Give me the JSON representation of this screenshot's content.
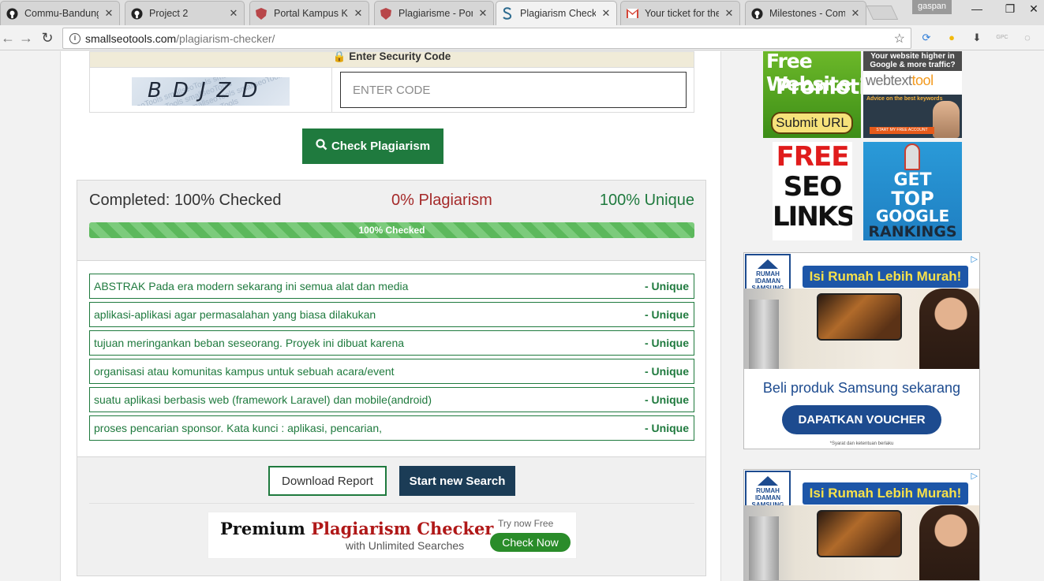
{
  "browser": {
    "tabs": [
      {
        "title": "Commu-Bandung",
        "icon": "github-icon",
        "active": false
      },
      {
        "title": "Project 2",
        "icon": "github-icon",
        "active": false
      },
      {
        "title": "Portal Kampus Ke",
        "icon": "campus-shield-icon",
        "active": false
      },
      {
        "title": "Plagiarisme - Port",
        "icon": "campus-shield-icon",
        "active": false
      },
      {
        "title": "Plagiarism Checke",
        "icon": "smallseotools-icon",
        "active": true
      },
      {
        "title": "Your ticket for the",
        "icon": "gmail-icon",
        "active": false
      },
      {
        "title": "Milestones - Com",
        "icon": "github-icon",
        "active": false
      }
    ],
    "user": "gaspan",
    "url_host": "smallseotools.com",
    "url_path": "/plagiarism-checker/"
  },
  "security": {
    "heading": "Enter Security Code",
    "captcha_text": "BDJZD",
    "input_placeholder": "ENTER CODE"
  },
  "check_button": "Check Plagiarism",
  "result": {
    "completed": "Completed: 100% Checked",
    "plagiarism": "0% Plagiarism",
    "unique": "100% Unique",
    "progress_label": "100% Checked",
    "progress_value": 1.0,
    "sentences": [
      {
        "text": "ABSTRAK Pada era modern sekarang ini semua alat dan media",
        "status": "- Unique"
      },
      {
        "text": "aplikasi-aplikasi agar permasalahan yang biasa dilakukan",
        "status": "- Unique"
      },
      {
        "text": "tujuan meringankan beban seseorang. Proyek ini dibuat karena",
        "status": "- Unique"
      },
      {
        "text": "organisasi atau komunitas kampus untuk sebuah acara/event",
        "status": "- Unique"
      },
      {
        "text": "suatu aplikasi berbasis web (framework Laravel) dan mobile(android)",
        "status": "- Unique"
      },
      {
        "text": "proses pencarian sponsor. Kata kunci : aplikasi, pencarian,",
        "status": "- Unique"
      }
    ],
    "download_label": "Download Report",
    "new_search_label": "Start new Search"
  },
  "premium": {
    "word1": "Premium",
    "word2": "Plagiarism Checker",
    "sub": "with Unlimited Searches",
    "try": "Try now Free",
    "cta": "Check Now"
  },
  "ads": {
    "free_promo": {
      "line1": "Free Website",
      "line2": "Promotion",
      "cta": "Submit URL"
    },
    "webtext": {
      "top": "Your website higher in Google & more traffic?",
      "brand_a": "webtext",
      "brand_b": "tool",
      "tag": "Advice on the best keywords",
      "btn": "START MY FREE ACCOUNT"
    },
    "seo": {
      "l1": "FREE",
      "l2": "SEO",
      "l3": "LINKS"
    },
    "top_rank": {
      "l1": "GET",
      "l2": "TOP",
      "l3": "GOOGLE",
      "l4": "RANKINGS"
    },
    "samsung": {
      "logo_text": "RUMAH IDAMAN SAMSUNG",
      "headline": "Isi Rumah Lebih Murah!",
      "body": "Beli produk Samsung sekarang",
      "cta": "DAPATKAN VOUCHER",
      "fine": "*Syarat dan ketentuan berlaku"
    }
  },
  "colors": {
    "brand_green": "#1f7a3e",
    "plag_red": "#a52a2a",
    "navy": "#1b3c56"
  }
}
